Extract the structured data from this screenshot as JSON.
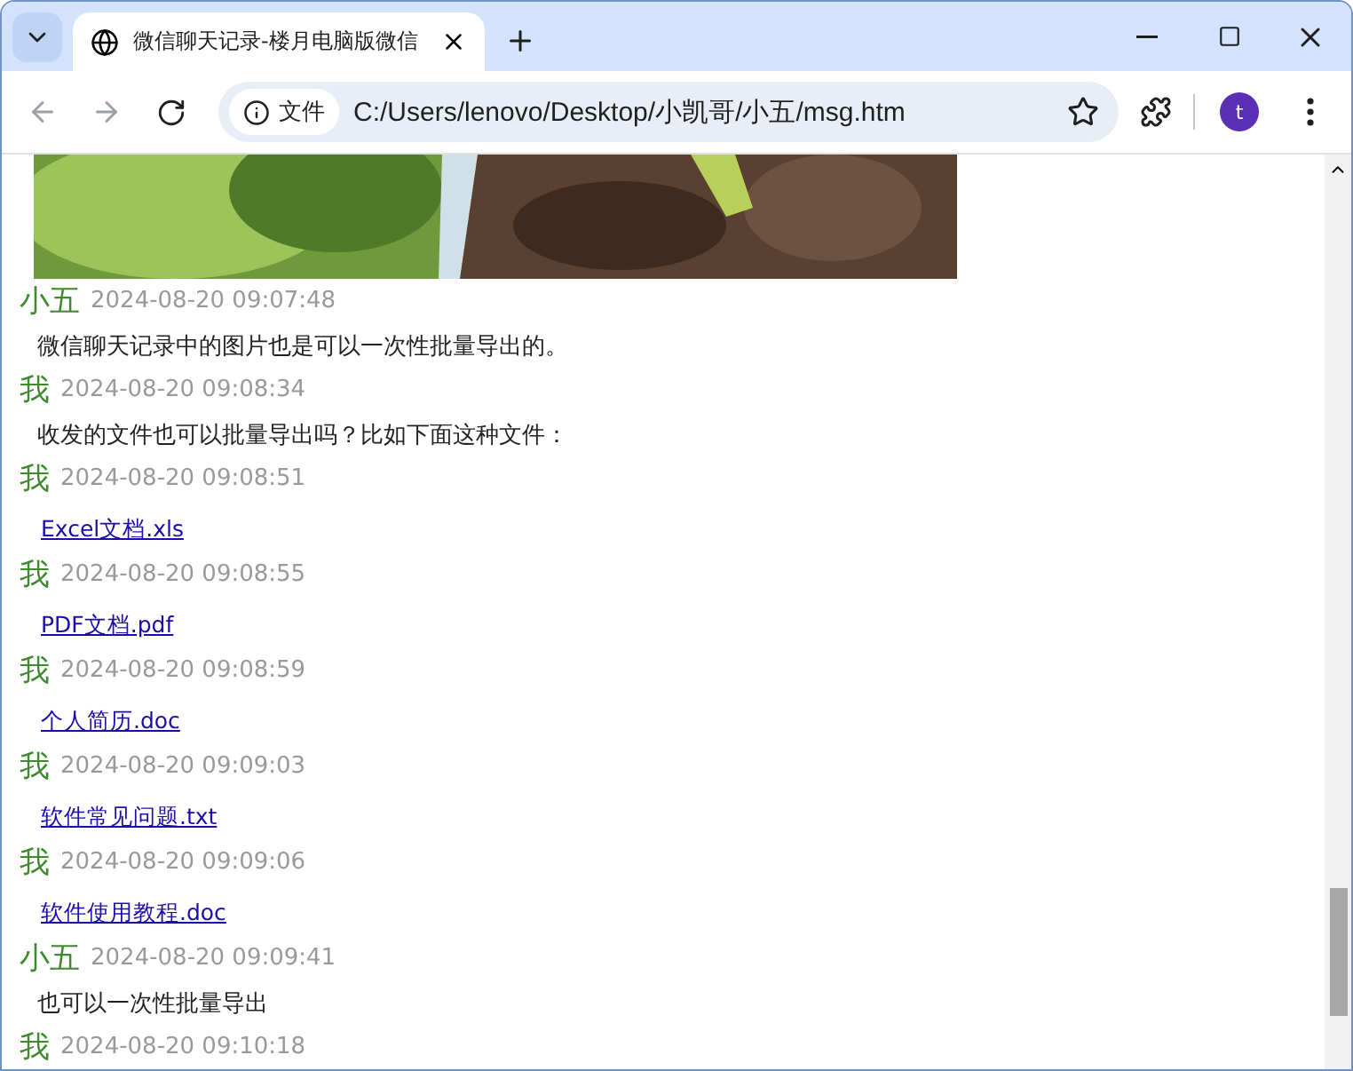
{
  "tab": {
    "title": "微信聊天记录-楼月电脑版微信"
  },
  "address_bar": {
    "security_label": "文件",
    "url": "C:/Users/lenovo/Desktop/小凯哥/小五/msg.htm"
  },
  "profile": {
    "initial": "t"
  },
  "messages": [
    {
      "sender": "小五",
      "time": "2024-08-20 09:07:48",
      "kind": "text",
      "content": "微信聊天记录中的图片也是可以一次性批量导出的。"
    },
    {
      "sender": "我",
      "time": "2024-08-20 09:08:34",
      "kind": "text",
      "content": "收发的文件也可以批量导出吗？比如下面这种文件："
    },
    {
      "sender": "我",
      "time": "2024-08-20 09:08:51",
      "kind": "file",
      "content": "Excel文档.xls"
    },
    {
      "sender": "我",
      "time": "2024-08-20 09:08:55",
      "kind": "file",
      "content": "PDF文档.pdf"
    },
    {
      "sender": "我",
      "time": "2024-08-20 09:08:59",
      "kind": "file",
      "content": "个人简历.doc"
    },
    {
      "sender": "我",
      "time": "2024-08-20 09:09:03",
      "kind": "file",
      "content": "软件常见问题.txt"
    },
    {
      "sender": "我",
      "time": "2024-08-20 09:09:06",
      "kind": "file",
      "content": "软件使用教程.doc"
    },
    {
      "sender": "小五",
      "time": "2024-08-20 09:09:41",
      "kind": "text",
      "content": "也可以一次性批量导出"
    },
    {
      "sender": "我",
      "time": "2024-08-20 09:10:18"
    }
  ]
}
